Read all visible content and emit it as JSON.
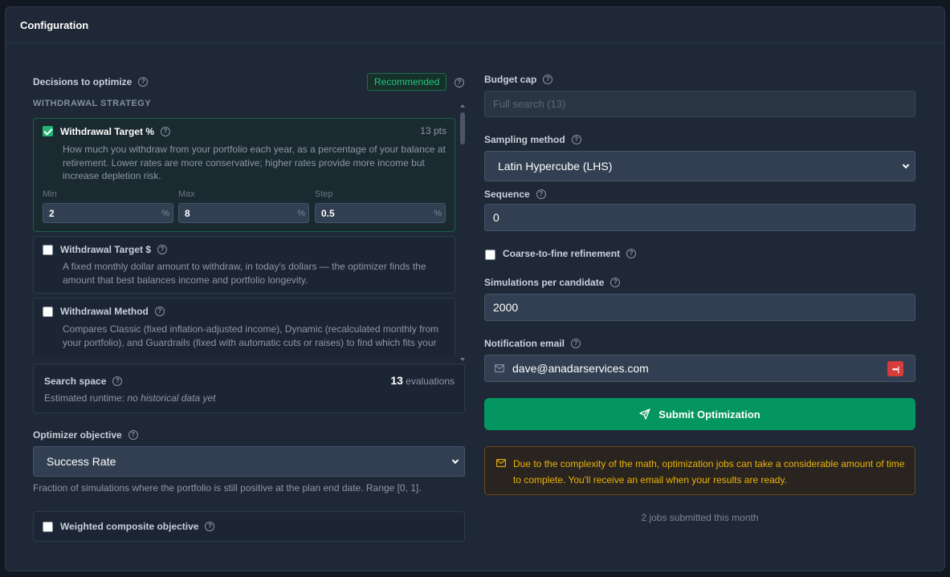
{
  "panel": {
    "title": "Configuration"
  },
  "decisions": {
    "label": "Decisions to optimize",
    "badge": "Recommended",
    "section_caption": "WITHDRAWAL STRATEGY",
    "items": [
      {
        "title": "Withdrawal Target %",
        "checked": true,
        "pts": "13 pts",
        "description": "How much you withdraw from your portfolio each year, as a percentage of your balance at retirement. Lower rates are more conservative; higher rates provide more income but increase depletion risk.",
        "min_label": "Min",
        "min_value": "2",
        "max_label": "Max",
        "max_value": "8",
        "step_label": "Step",
        "step_value": "0.5",
        "unit": "%"
      },
      {
        "title": "Withdrawal Target $",
        "checked": false,
        "description": "A fixed monthly dollar amount to withdraw, in today's dollars — the optimizer finds the amount that best balances income and portfolio longevity."
      },
      {
        "title": "Withdrawal Method",
        "checked": false,
        "description": "Compares Classic (fixed inflation-adjusted income), Dynamic (recalculated monthly from your portfolio), and Guardrails (fixed with automatic cuts or raises) to find which fits your"
      }
    ]
  },
  "search_space": {
    "label": "Search space",
    "count": "13",
    "count_suffix": "evaluations",
    "runtime_label": "Estimated runtime:",
    "runtime_value": "no historical data yet"
  },
  "objective": {
    "label": "Optimizer objective",
    "selected": "Success Rate",
    "hint": "Fraction of simulations where the portfolio is still positive at the plan end date. Range [0, 1]."
  },
  "weighted": {
    "label": "Weighted composite objective",
    "checked": false
  },
  "budget": {
    "label": "Budget cap",
    "placeholder": "Full search (13)"
  },
  "sampling": {
    "label": "Sampling method",
    "selected": "Latin Hypercube (LHS)"
  },
  "sequence": {
    "label": "Sequence",
    "value": "0"
  },
  "refinement": {
    "label": "Coarse-to-fine refinement",
    "checked": false
  },
  "simulations": {
    "label": "Simulations per candidate",
    "value": "2000"
  },
  "email": {
    "label": "Notification email",
    "value": "dave@anadarservices.com",
    "icon": "mail-icon",
    "manager_icon": "password-manager-icon"
  },
  "submit": {
    "label": "Submit Optimization",
    "icon": "send-icon",
    "color": "#039661"
  },
  "notice": {
    "text": "Due to the complexity of the math, optimization jobs can take a considerable amount of time to complete. You'll receive an email when your results are ready.",
    "icon": "mail-icon",
    "color": "#eab308"
  },
  "footer": {
    "jobs_text": "2 jobs submitted this month"
  }
}
